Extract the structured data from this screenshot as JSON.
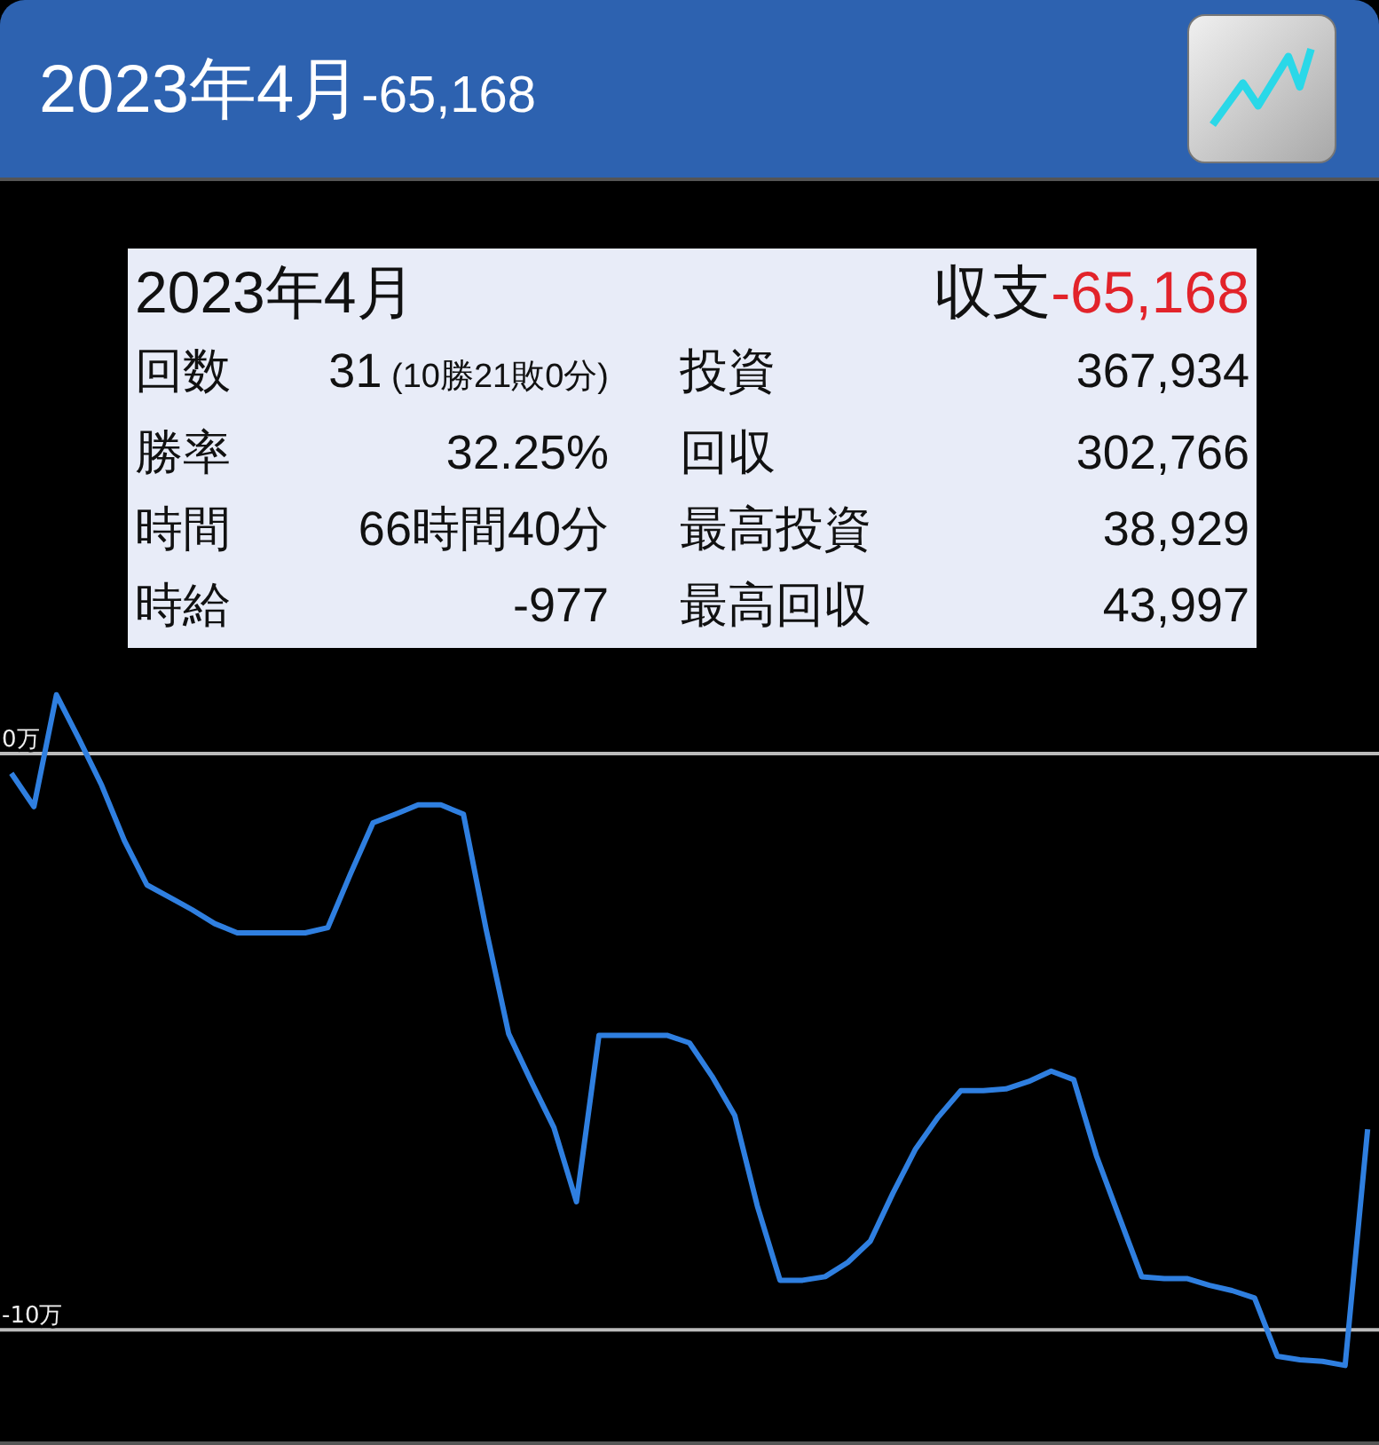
{
  "header": {
    "title": "2023年4月",
    "total": "-65,168"
  },
  "summary": {
    "title": "2023年4月",
    "balance_label": "収支",
    "balance": "-65,168",
    "rows": [
      {
        "left": {
          "label": "回数",
          "value": "31",
          "note": "(10勝21敗0分)"
        },
        "right": {
          "label": "投資",
          "value": "367,934"
        }
      },
      {
        "left": {
          "label": "勝率",
          "value": "32.25%"
        },
        "right": {
          "label": "回収",
          "value": "302,766"
        }
      },
      {
        "left": {
          "label": "時間",
          "value": "66時間40分"
        },
        "right": {
          "label": "最高投資",
          "value": "38,929"
        }
      },
      {
        "left": {
          "label": "時給",
          "value": "-977"
        },
        "right": {
          "label": "最高回収",
          "value": "43,997"
        }
      }
    ]
  },
  "chart": {
    "chart_data": {
      "type": "line",
      "ylim": [
        -12,
        10
      ],
      "yticks": [
        {
          "value": 0,
          "label": "0万"
        },
        {
          "value": -10,
          "label": "-10万"
        }
      ],
      "categories": [
        null,
        null,
        null,
        null,
        null,
        null,
        null,
        null,
        null,
        null,
        null,
        null,
        null,
        null,
        null,
        null,
        null,
        null,
        null,
        null,
        null,
        null,
        null,
        null,
        null,
        null,
        null,
        null,
        null,
        null,
        null,
        null,
        null,
        null,
        null,
        null,
        null,
        null,
        null,
        null,
        null,
        null,
        null,
        null,
        null,
        null,
        null,
        null,
        null,
        null,
        null,
        null,
        null,
        null,
        null,
        null,
        null,
        null,
        null,
        null,
        null
      ],
      "series": [
        {
          "color": "#2f7fe0",
          "values": [
            -0.34,
            -0.92,
            1.02,
            0.25,
            -0.55,
            -1.51,
            -2.28,
            -2.49,
            -2.71,
            -2.95,
            -3.11,
            -3.11,
            -3.11,
            -3.11,
            -3.02,
            -2.09,
            -1.2,
            -1.05,
            -0.89,
            -0.89,
            -1.05,
            -3.05,
            -4.86,
            -5.69,
            -6.49,
            -7.78,
            -4.89,
            -4.89,
            -4.89,
            -4.89,
            -5.02,
            -5.6,
            -6.28,
            -7.85,
            -9.14,
            -9.14,
            -9.08,
            -8.83,
            -8.46,
            -7.63,
            -6.86,
            -6.31,
            -5.85,
            -5.85,
            -5.82,
            -5.69,
            -5.51,
            -5.66,
            -6.98,
            -8.03,
            -9.08,
            -9.11,
            -9.11,
            -9.23,
            -9.32,
            -9.45,
            -10.46,
            -10.52,
            -10.55,
            -10.62,
            -6.52
          ]
        }
      ]
    }
  }
}
